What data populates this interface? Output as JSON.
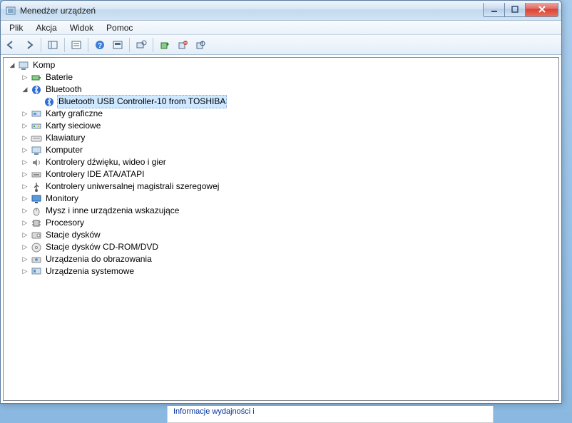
{
  "window": {
    "title": "Menedżer urządzeń"
  },
  "menu": {
    "file": "Plik",
    "action": "Akcja",
    "view": "Widok",
    "help": "Pomoc"
  },
  "tree": {
    "root": "Komp",
    "baterie": "Baterie",
    "bluetooth": "Bluetooth",
    "bluetooth_device": "Bluetooth USB Controller-10 from TOSHIBA",
    "karty_graficzne": "Karty graficzne",
    "karty_sieciowe": "Karty sieciowe",
    "klawiatury": "Klawiatury",
    "komputer": "Komputer",
    "kontrolery_audio": "Kontrolery dźwięku, wideo i gier",
    "kontrolery_ide": "Kontrolery IDE ATA/ATAPI",
    "kontrolery_usb": "Kontrolery uniwersalnej magistrali szeregowej",
    "monitory": "Monitory",
    "mysz": "Mysz i inne urządzenia wskazujące",
    "procesory": "Procesory",
    "stacje_dyskow": "Stacje dysków",
    "stacje_cdrom": "Stacje dysków CD-ROM/DVD",
    "urz_obraz": "Urządzenia do obrazowania",
    "urz_systemowe": "Urządzenia systemowe"
  },
  "behind": {
    "text": "Informacje wydajności i"
  }
}
